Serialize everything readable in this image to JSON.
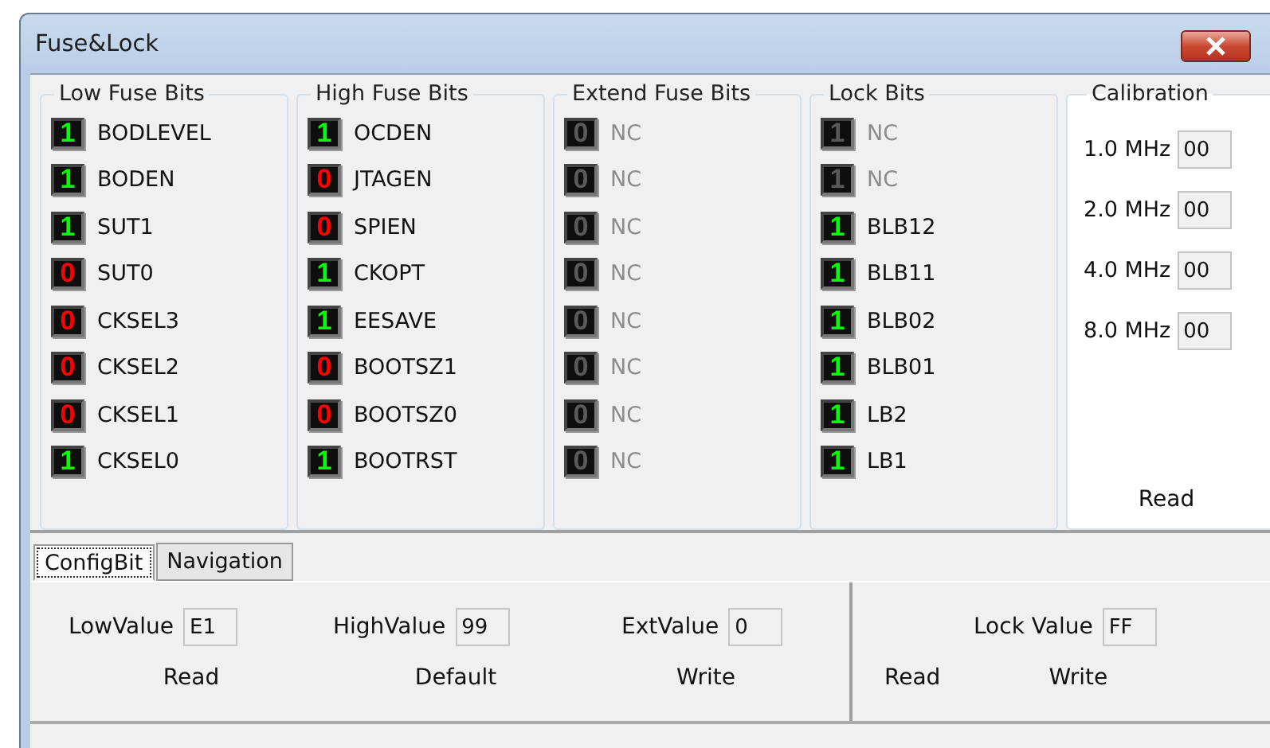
{
  "window": {
    "title": "Fuse&Lock"
  },
  "groups": [
    {
      "title": "Low Fuse Bits",
      "bits": [
        {
          "value": "1",
          "name": "BODLEVEL",
          "disabled": false
        },
        {
          "value": "1",
          "name": "BODEN",
          "disabled": false
        },
        {
          "value": "1",
          "name": "SUT1",
          "disabled": false
        },
        {
          "value": "0",
          "name": "SUT0",
          "disabled": false
        },
        {
          "value": "0",
          "name": "CKSEL3",
          "disabled": false
        },
        {
          "value": "0",
          "name": "CKSEL2",
          "disabled": false
        },
        {
          "value": "0",
          "name": "CKSEL1",
          "disabled": false
        },
        {
          "value": "1",
          "name": "CKSEL0",
          "disabled": false
        }
      ]
    },
    {
      "title": "High Fuse Bits",
      "bits": [
        {
          "value": "1",
          "name": "OCDEN",
          "disabled": false
        },
        {
          "value": "0",
          "name": "JTAGEN",
          "disabled": false
        },
        {
          "value": "0",
          "name": "SPIEN",
          "disabled": false
        },
        {
          "value": "1",
          "name": "CKOPT",
          "disabled": false
        },
        {
          "value": "1",
          "name": "EESAVE",
          "disabled": false
        },
        {
          "value": "0",
          "name": "BOOTSZ1",
          "disabled": false
        },
        {
          "value": "0",
          "name": "BOOTSZ0",
          "disabled": false
        },
        {
          "value": "1",
          "name": "BOOTRST",
          "disabled": false
        }
      ]
    },
    {
      "title": "Extend Fuse Bits",
      "bits": [
        {
          "value": "0",
          "name": "NC",
          "disabled": true
        },
        {
          "value": "0",
          "name": "NC",
          "disabled": true
        },
        {
          "value": "0",
          "name": "NC",
          "disabled": true
        },
        {
          "value": "0",
          "name": "NC",
          "disabled": true
        },
        {
          "value": "0",
          "name": "NC",
          "disabled": true
        },
        {
          "value": "0",
          "name": "NC",
          "disabled": true
        },
        {
          "value": "0",
          "name": "NC",
          "disabled": true
        },
        {
          "value": "0",
          "name": "NC",
          "disabled": true
        }
      ]
    },
    {
      "title": "Lock Bits",
      "bits": [
        {
          "value": "1",
          "name": "NC",
          "disabled": true
        },
        {
          "value": "1",
          "name": "NC",
          "disabled": true
        },
        {
          "value": "1",
          "name": "BLB12",
          "disabled": false
        },
        {
          "value": "1",
          "name": "BLB11",
          "disabled": false
        },
        {
          "value": "1",
          "name": "BLB02",
          "disabled": false
        },
        {
          "value": "1",
          "name": "BLB01",
          "disabled": false
        },
        {
          "value": "1",
          "name": "LB2",
          "disabled": false
        },
        {
          "value": "1",
          "name": "LB1",
          "disabled": false
        }
      ]
    }
  ],
  "calibration": {
    "title": "Calibration",
    "rows": [
      {
        "label": "1.0 MHz",
        "value": "00"
      },
      {
        "label": "2.0 MHz",
        "value": "00"
      },
      {
        "label": "4.0 MHz",
        "value": "00"
      },
      {
        "label": "8.0 MHz",
        "value": "00"
      }
    ],
    "button": "Read"
  },
  "tabs": [
    {
      "label": "ConfigBit",
      "selected": true
    },
    {
      "label": "Navigation",
      "selected": false
    }
  ],
  "fuse_values": [
    {
      "label": "LowValue",
      "value": "E1"
    },
    {
      "label": "HighValue",
      "value": "99"
    },
    {
      "label": "ExtValue",
      "value": "0"
    }
  ],
  "fuse_buttons": [
    "Read",
    "Default",
    "Write"
  ],
  "lock": {
    "label": "Lock Value",
    "value": "FF",
    "buttons": [
      "Read",
      "Write"
    ]
  }
}
